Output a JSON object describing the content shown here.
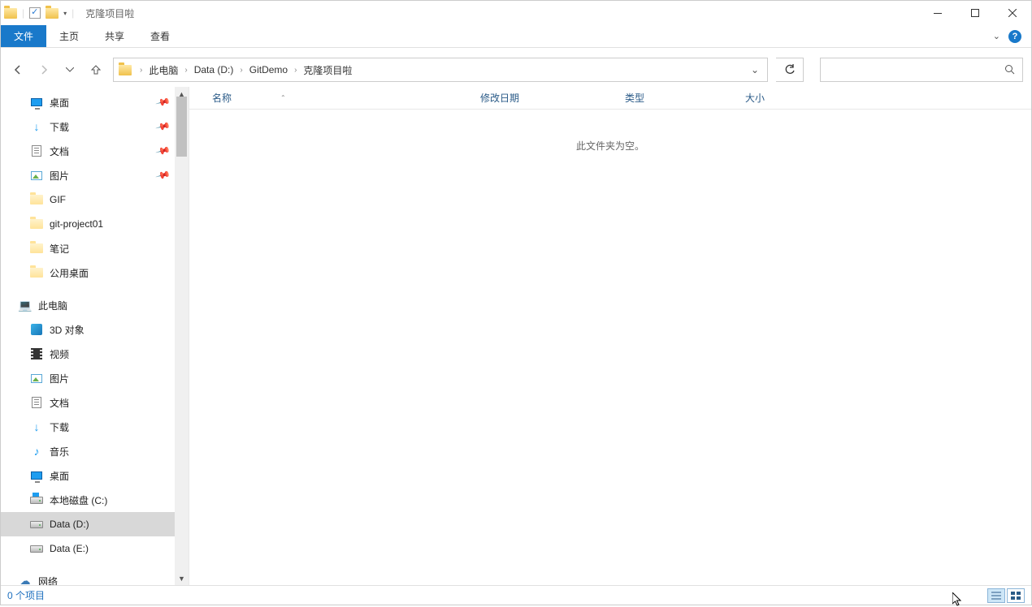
{
  "window": {
    "title": "克隆项目啦"
  },
  "ribbon": {
    "file": "文件",
    "tabs": [
      "主页",
      "共享",
      "查看"
    ]
  },
  "breadcrumbs": [
    "此电脑",
    "Data (D:)",
    "GitDemo",
    "克隆项目啦"
  ],
  "columns": {
    "name": "名称",
    "date": "修改日期",
    "type": "类型",
    "size": "大小"
  },
  "empty_message": "此文件夹为空。",
  "status": {
    "items": "0 个项目"
  },
  "sidebar": {
    "quick": [
      {
        "label": "桌面",
        "icon": "ic-monitor",
        "pinned": true
      },
      {
        "label": "下载",
        "icon": "ic-down-arrow",
        "pinned": true
      },
      {
        "label": "文档",
        "icon": "ic-doc",
        "pinned": true
      },
      {
        "label": "图片",
        "icon": "ic-pic",
        "pinned": true
      },
      {
        "label": "GIF",
        "icon": "ic-folder light",
        "pinned": false
      },
      {
        "label": "git-project01",
        "icon": "ic-folder light",
        "pinned": false
      },
      {
        "label": "笔记",
        "icon": "ic-folder light",
        "pinned": false
      },
      {
        "label": "公用桌面",
        "icon": "ic-folder light",
        "pinned": false
      }
    ],
    "this_pc_label": "此电脑",
    "this_pc": [
      {
        "label": "3D 对象",
        "icon": "ic-3d"
      },
      {
        "label": "视频",
        "icon": "ic-video"
      },
      {
        "label": "图片",
        "icon": "ic-pic"
      },
      {
        "label": "文档",
        "icon": "ic-doc"
      },
      {
        "label": "下载",
        "icon": "ic-down-arrow"
      },
      {
        "label": "音乐",
        "icon": "ic-music"
      },
      {
        "label": "桌面",
        "icon": "ic-monitor"
      },
      {
        "label": "本地磁盘 (C:)",
        "icon": "ic-drive win"
      },
      {
        "label": "Data (D:)",
        "icon": "ic-drive",
        "selected": true
      },
      {
        "label": "Data (E:)",
        "icon": "ic-drive"
      }
    ],
    "network_label": "网络"
  }
}
